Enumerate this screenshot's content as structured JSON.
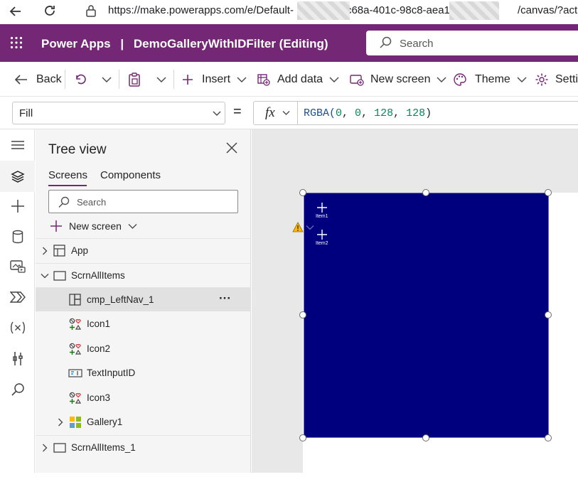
{
  "browser": {
    "url_start": "https://make.powerapps.com/e/Default-",
    "url_mid": "c68a-401c-98c8-aea128e",
    "url_end": "/canvas/?action="
  },
  "header": {
    "app_name": "Power Apps",
    "divider": "|",
    "document_title": "DemoGalleryWithIDFilter (Editing)",
    "search_placeholder": "Search"
  },
  "commandbar": {
    "back": "Back",
    "insert": "Insert",
    "add_data": "Add data",
    "new_screen": "New screen",
    "theme": "Theme",
    "settings": "Setti"
  },
  "formulabar": {
    "property": "Fill",
    "equals": "=",
    "fx": "fx",
    "formula_func": "RGBA(",
    "formula_args": [
      "0",
      "0",
      "128",
      "128"
    ],
    "formula_close": ")"
  },
  "tree": {
    "title": "Tree view",
    "tabs": [
      "Screens",
      "Components"
    ],
    "search_placeholder": "Search",
    "new_screen": "New screen",
    "items": [
      {
        "label": "App"
      },
      {
        "label": "ScrnAllItems"
      },
      {
        "label": "cmp_LeftNav_1",
        "more": "···"
      },
      {
        "label": "Icon1"
      },
      {
        "label": "Icon2"
      },
      {
        "label": "TextInputID"
      },
      {
        "label": "Icon3"
      },
      {
        "label": "Gallery1"
      },
      {
        "label": "ScrnAllItems_1"
      }
    ]
  },
  "canvas": {
    "nav_items": [
      "Item1",
      "Item2"
    ],
    "component_color": "#00007F"
  },
  "colors": {
    "brand": "#742774",
    "formula_number": "#098658",
    "formula_func": "#1F4E8C"
  },
  "icons": {
    "rail": [
      "hamburger-icon",
      "layers-icon",
      "plus-icon",
      "database-icon",
      "media-icon",
      "flow-icon",
      "variables-icon",
      "tools-icon",
      "search-icon"
    ]
  }
}
